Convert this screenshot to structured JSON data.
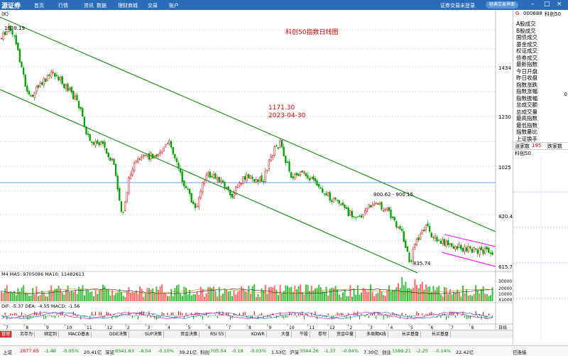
{
  "app": {
    "logo": "源证券",
    "menu": [
      "首页",
      "行情",
      "资讯",
      "数据",
      "理财商城",
      "交易",
      "账户"
    ],
    "top_right_text": "证券交易未登录",
    "classic_btn": "经典交易界面",
    "window_controls": [
      "–",
      "□",
      "×"
    ]
  },
  "chart": {
    "title": "科创50指数日线图",
    "indicator_label": "(K)",
    "high_label": "1639.19",
    "low_label": "835.74",
    "point_label": "900.62 - 900.15",
    "annotation_value": "1171.30",
    "annotation_date": "2023-04-30",
    "price_ticks": [
      "1434",
      "1230",
      "1025",
      "820.4",
      "615.7"
    ],
    "volume_header": "M4 MA5: 9705086 MA10: 11482613",
    "volume_ticks": [
      "30000",
      "20000",
      "10000",
      "X1000"
    ],
    "macd_header": "DIF: -5.37 DEA: -4.55 MACD: -1.56",
    "time_labels": [
      "7",
      "8",
      "9",
      "10",
      "11",
      "12",
      "2",
      "3",
      "4",
      "5",
      "6",
      "7",
      "8",
      "9",
      "10",
      "11",
      "12",
      "2",
      "3",
      "4",
      "5",
      "6",
      "7",
      "8"
    ],
    "day_label": "日线"
  },
  "tabs": [
    "管理",
    "另存为",
    "绑定到",
    "MACD基本",
    "DDE决策",
    "SUP决策",
    "资金决策",
    "RSI 55",
    "KDWR",
    "大盘",
    "牛股",
    "卷帘",
    "资金中量",
    "多周期K线",
    "长买基盘",
    "长买基盘"
  ],
  "sidebar": {
    "code": "000688",
    "name": "科创50",
    "prefix": "G",
    "rows": [
      "A股成交",
      "B股成交",
      "国债成交",
      "基金成交",
      "权证成交",
      "债券成交",
      "最新指数",
      "今日开盘",
      "昨日收盘",
      "指数涨跌",
      "指数涨幅",
      "指数振幅",
      "总成交额",
      "总成交量",
      "最高指数",
      "最低指数",
      "指数量比",
      "上证换手"
    ],
    "special_value": "0",
    "up_count_label": "涨家数",
    "up_count": "195",
    "down_count_label": "跌家数",
    "bottom_label": "科创50"
  },
  "status": {
    "prefix": "上证",
    "items": [
      {
        "label": "2877.65",
        "color": "red"
      },
      {
        "label": "-1.48",
        "color": "green"
      },
      {
        "label": "-0.05%",
        "color": "green"
      },
      {
        "label": "20.41亿",
        "color": ""
      },
      {
        "label": "深证",
        "color": ""
      },
      {
        "label": "8341.83",
        "color": "green"
      },
      {
        "label": "-8.04",
        "color": "green"
      },
      {
        "label": "-0.10%",
        "color": "green"
      },
      {
        "label": "39.21亿",
        "color": ""
      },
      {
        "label": "科创",
        "color": ""
      },
      {
        "label": "705.04",
        "color": "green"
      },
      {
        "label": "-0.18",
        "color": "green"
      },
      {
        "label": "-0.03%",
        "color": "green"
      },
      {
        "label": "1.53亿",
        "color": ""
      },
      {
        "label": "沪深",
        "color": ""
      },
      {
        "label": "3344.26",
        "color": "green"
      },
      {
        "label": "-1.37",
        "color": "green"
      },
      {
        "label": "-0.04%",
        "color": "green"
      },
      {
        "label": "7.30亿",
        "color": ""
      },
      {
        "label": "创业",
        "color": ""
      },
      {
        "label": "1589.21",
        "color": "green"
      },
      {
        "label": "-2.25",
        "color": "green"
      },
      {
        "label": "-0.14%",
        "color": "green"
      },
      {
        "label": "22.42亿",
        "color": ""
      }
    ],
    "connected": "已连接"
  },
  "colors": {
    "up": "#d40000",
    "down": "#00a000",
    "channel": "#1f8f1f",
    "pink": "#ff00ff",
    "grid": "#5b8fd6"
  }
}
